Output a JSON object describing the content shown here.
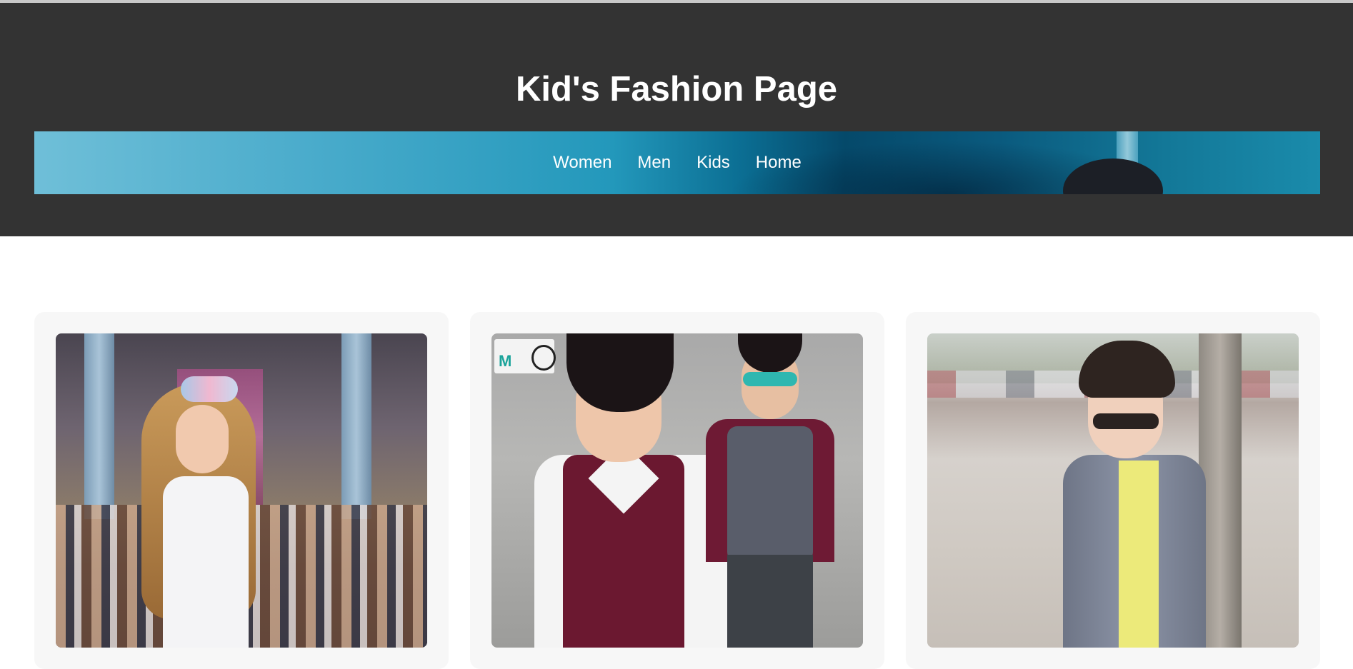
{
  "header": {
    "title": "Kid's Fashion Page"
  },
  "nav": {
    "items": [
      {
        "label": "Women"
      },
      {
        "label": "Men"
      },
      {
        "label": "Kids"
      },
      {
        "label": "Home"
      }
    ]
  },
  "colors": {
    "header_bg": "#333333",
    "card_bg": "#f7f7f7",
    "nav_text": "#ffffff"
  },
  "cards": [
    {
      "image": "girl-runway-photo"
    },
    {
      "image": "two-boys-vest-photo"
    },
    {
      "image": "boy-sunglasses-photo"
    }
  ]
}
